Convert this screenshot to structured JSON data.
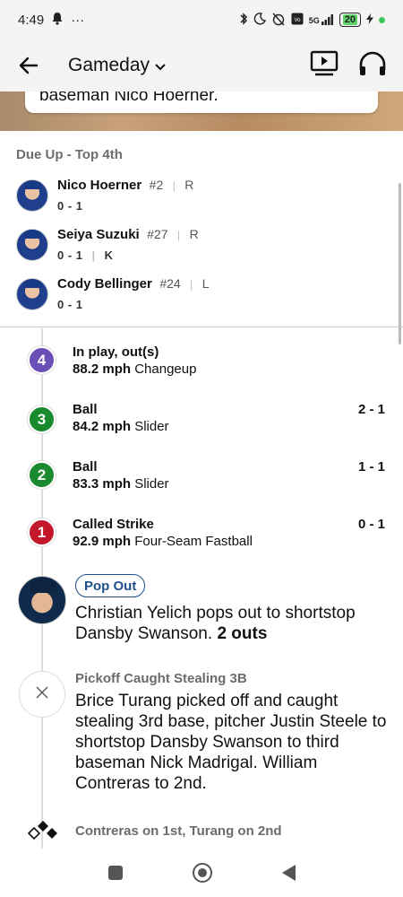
{
  "status_bar": {
    "time": "4:49",
    "dots": "···",
    "network": "5G",
    "battery": "20"
  },
  "app_bar": {
    "title": "Gameday"
  },
  "hero": {
    "card_text": "baseman Nico Hoerner."
  },
  "due_up": {
    "header": "Due Up - Top 4th",
    "batters": [
      {
        "name": "Nico Hoerner",
        "number": "#2",
        "hand": "R",
        "stat": "0 - 1",
        "extra": ""
      },
      {
        "name": "Seiya Suzuki",
        "number": "#27",
        "hand": "R",
        "stat": "0 - 1",
        "extra": "K"
      },
      {
        "name": "Cody Bellinger",
        "number": "#24",
        "hand": "L",
        "stat": "0 - 1",
        "extra": ""
      }
    ]
  },
  "pitches": [
    {
      "number": "4",
      "result": "In play, out(s)",
      "speed": "88.2 mph",
      "type": "Changeup",
      "count": "",
      "color": "#6a4fb6"
    },
    {
      "number": "3",
      "result": "Ball",
      "speed": "84.2 mph",
      "type": "Slider",
      "count": "2 - 1",
      "color": "#1a8a2e"
    },
    {
      "number": "2",
      "result": "Ball",
      "speed": "83.3 mph",
      "type": "Slider",
      "count": "1 - 1",
      "color": "#1a8a2e"
    },
    {
      "number": "1",
      "result": "Called Strike",
      "speed": "92.9 mph",
      "type": "Four-Seam Fastball",
      "count": "0 - 1",
      "color": "#c4182a"
    }
  ],
  "play": {
    "badge": "Pop Out",
    "description": "Christian Yelich pops out to shortstop Dansby Swanson.",
    "outs": "2 outs"
  },
  "event": {
    "label": "Pickoff Caught Stealing 3B",
    "description": "Brice Turang picked off and caught stealing 3rd base, pitcher Justin Steele to shortstop Dansby Swanson to third baseman Nick Madrigal. William Contreras to 2nd."
  },
  "bases": {
    "label": "Contreras on 1st, Turang on 2nd"
  }
}
